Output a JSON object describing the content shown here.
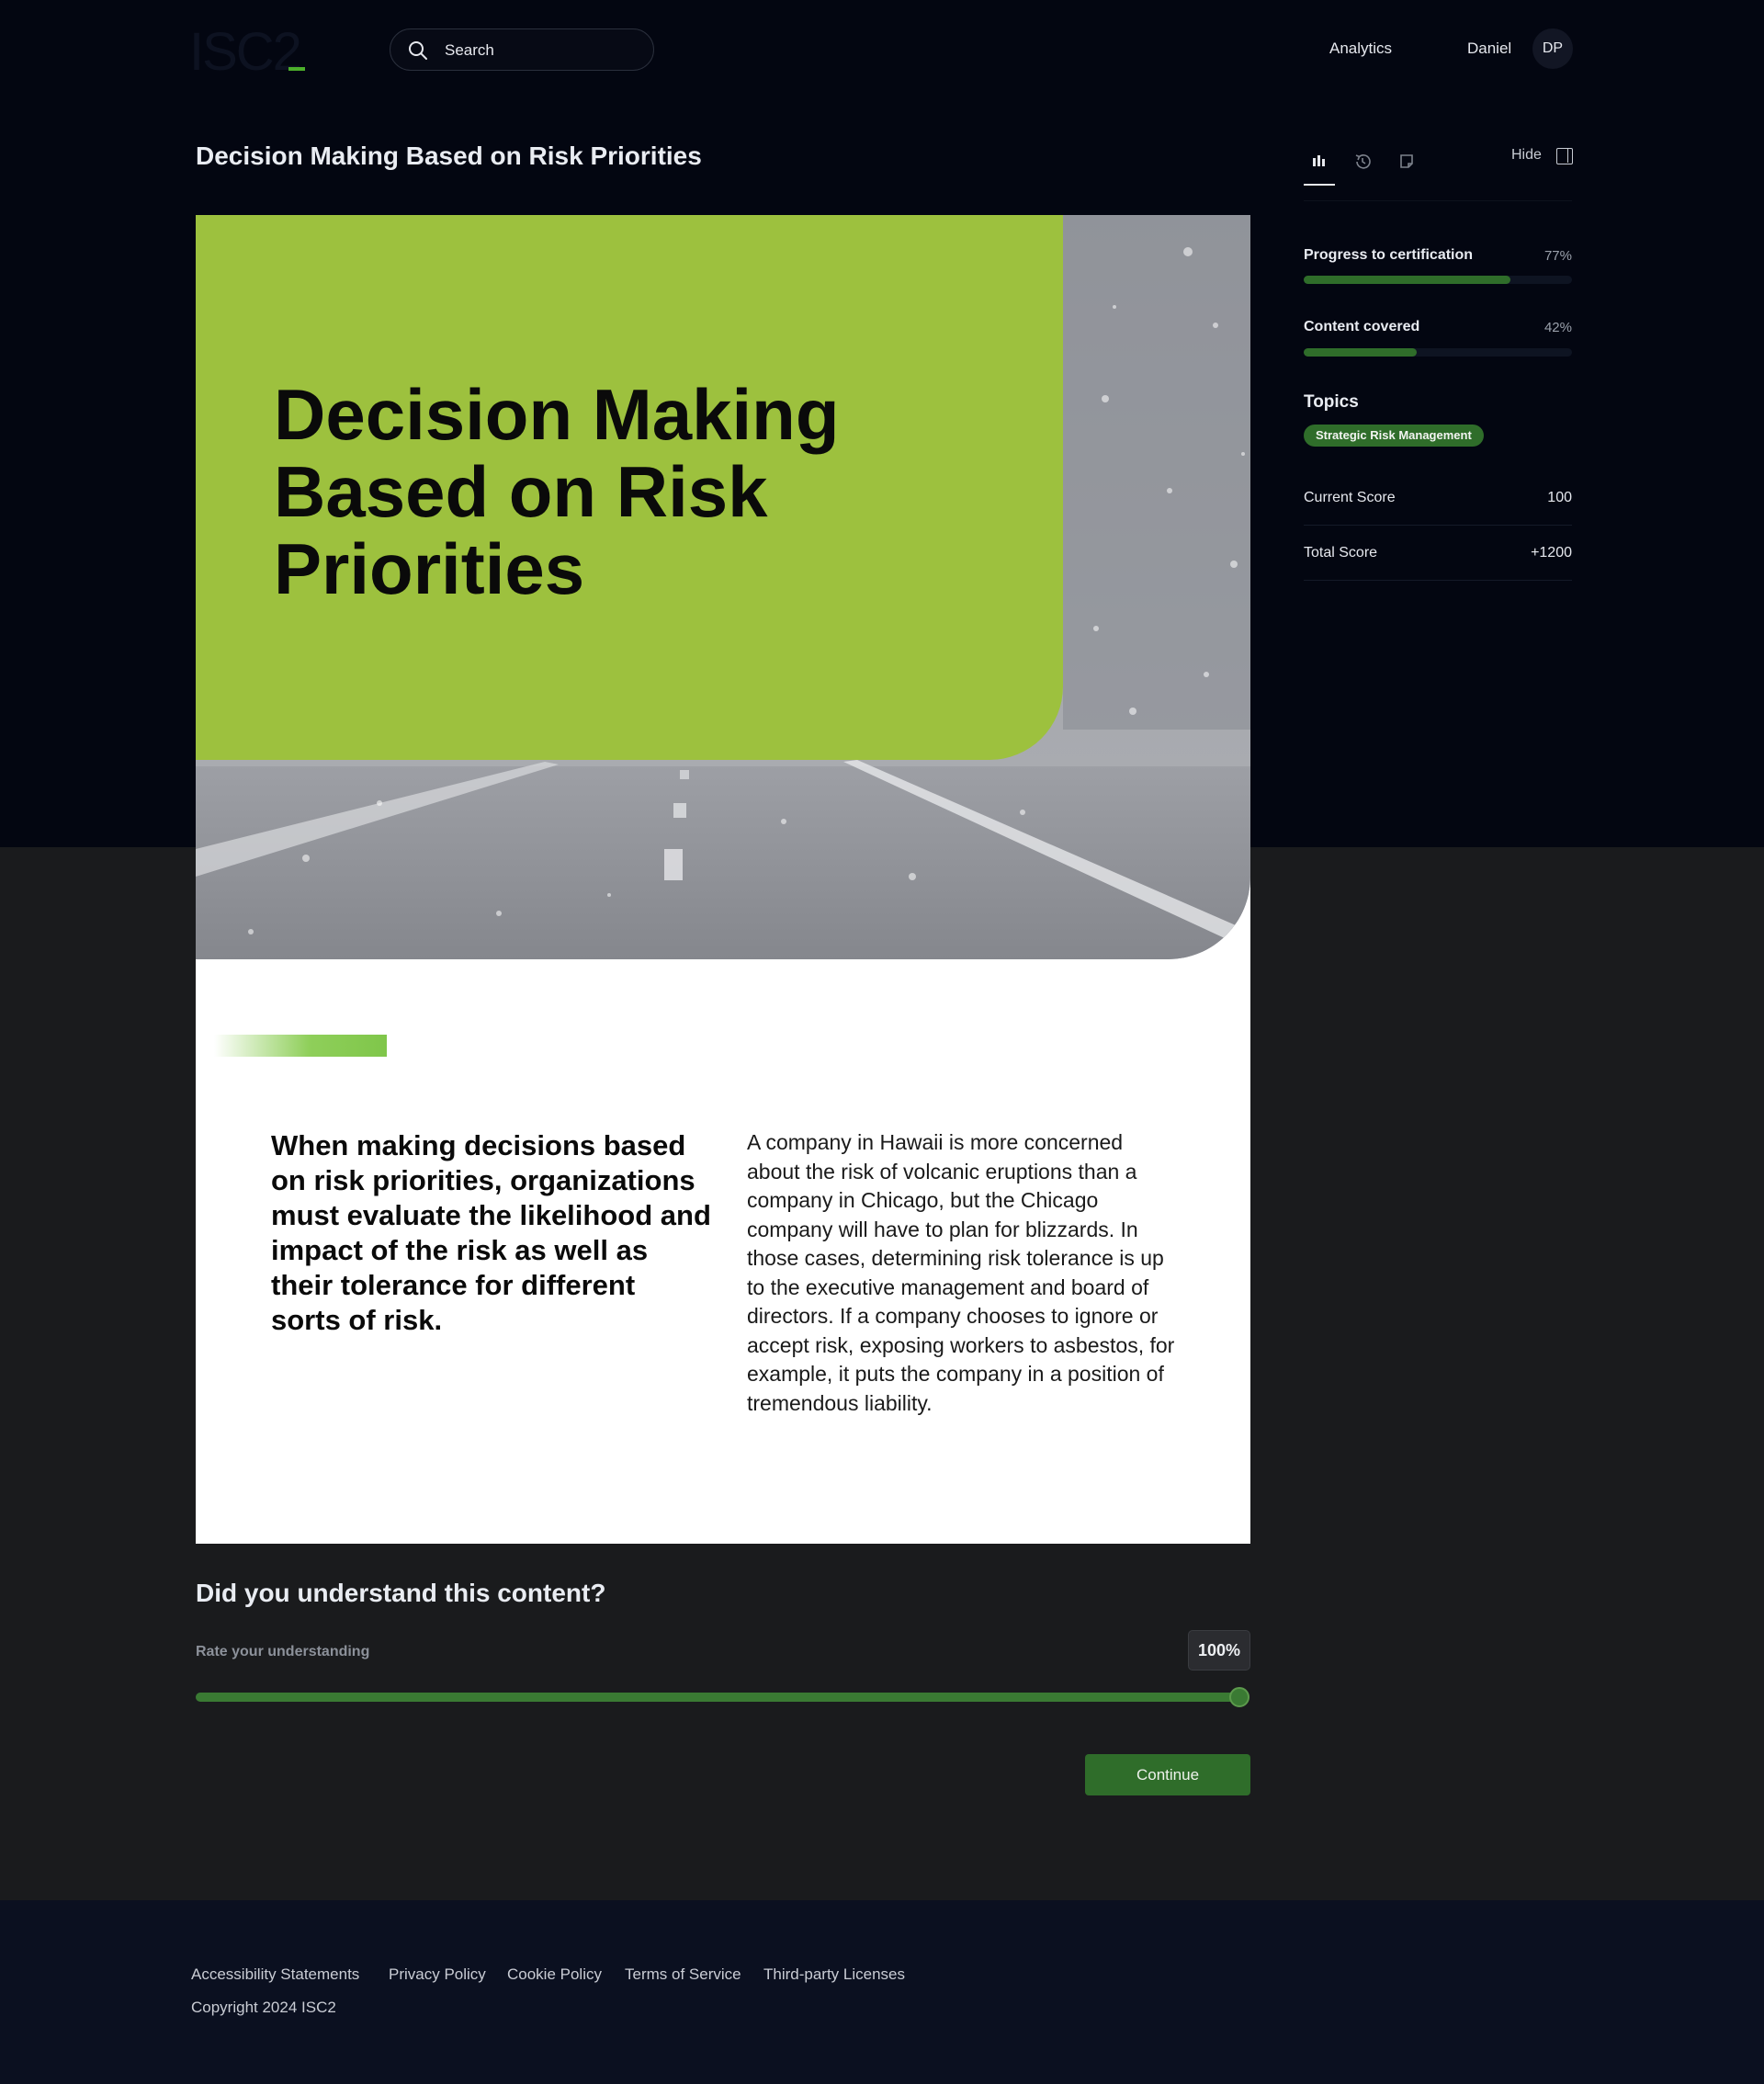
{
  "header": {
    "logo_text": "ISC2",
    "search_placeholder": "Search",
    "nav_analytics": "Analytics",
    "user_name": "Daniel",
    "user_initials": "DP"
  },
  "page": {
    "title": "Decision Making Based on Risk Priorities"
  },
  "side_panel": {
    "tabs": [
      "stats-icon",
      "history-icon",
      "notes-icon"
    ],
    "hide_label": "Hide",
    "progress_label": "Progress to certification",
    "progress_value": "77%",
    "progress_fraction": 0.77,
    "content_label": "Content covered",
    "content_value": "42%",
    "content_fraction": 0.42,
    "topics_title": "Topics",
    "topic_chip": "Strategic Risk Management",
    "current_score_label": "Current Score",
    "current_score_value": "100",
    "total_score_label": "Total Score",
    "total_score_value": "+1200"
  },
  "lesson": {
    "hero_title": "Decision Making Based on Risk Priorities",
    "lead": "When making decisions based on risk priorities, organizations must evaluate the likelihood and impact of the risk as well as their tolerance for different sorts of risk.",
    "body": "A company in Hawaii is more concerned about the risk of volcanic eruptions than a company in Chicago, but the Chicago company will have to plan for blizzards. In those cases, determining risk tolerance is up to the executive management and board of directors. If a company chooses to ignore or accept risk, exposing workers to asbestos, for example, it puts the company in a position of tremendous liability."
  },
  "feedback": {
    "question": "Did you understand this content?",
    "rate_label": "Rate your understanding",
    "rate_value": "100%",
    "rate_fraction": 1.0,
    "continue_label": "Continue"
  },
  "footer": {
    "links": [
      "Accessibility Statements",
      "Privacy Policy",
      "Cookie Policy",
      "Terms of Service",
      "Third-party Licenses"
    ],
    "copyright": "Copyright 2024 ISC2"
  },
  "colors": {
    "accent_green": "#2f6d2a",
    "hero_green": "#9dc13e",
    "background_dark": "#030611"
  }
}
